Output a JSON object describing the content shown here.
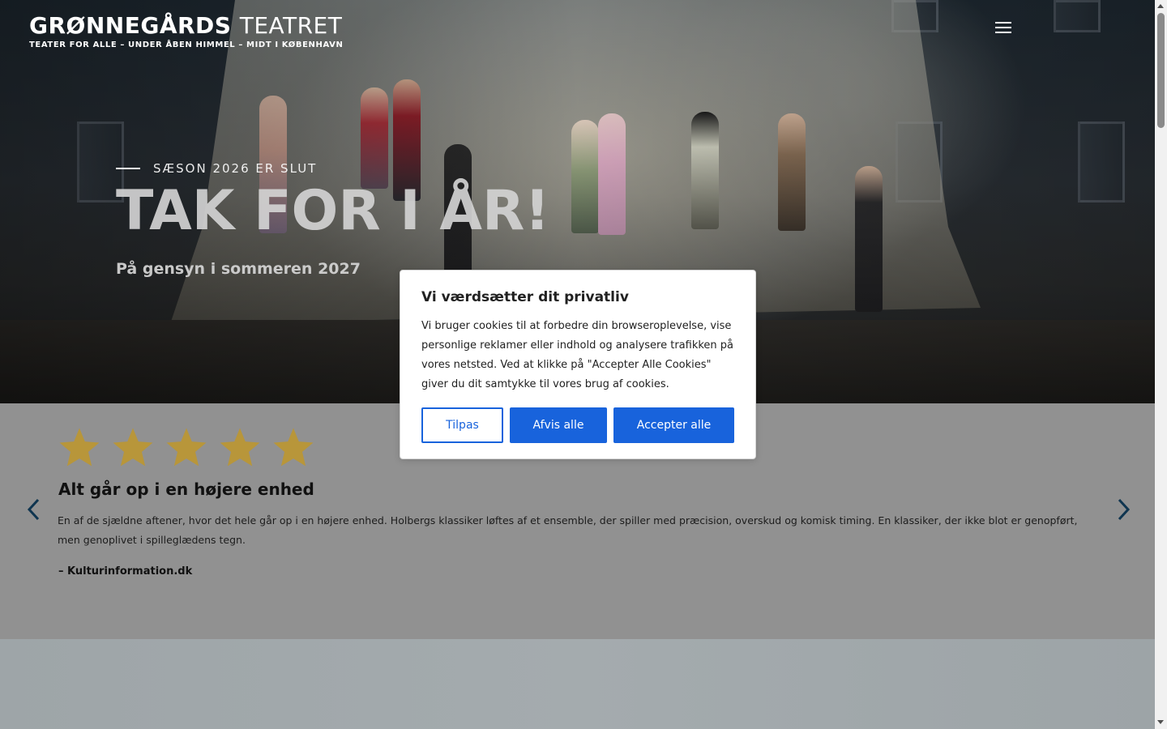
{
  "header": {
    "logo_bold": "GRØNNEGÅRDS",
    "logo_light": "TEATRET",
    "logo_tagline": "TEATER FOR ALLE – UNDER ÅBEN HIMMEL – MIDT I KØBENHAVN",
    "menu_icon": "hamburger-menu-icon"
  },
  "hero": {
    "eyebrow": "SÆSON 2026 ER SLUT",
    "title": "TAK FOR I ÅR!",
    "subtitle": "På gensyn i sommeren 2027"
  },
  "review": {
    "rating": 5,
    "rating_max": 5,
    "star_color": "#b8963a",
    "title": "Alt går op i en højere enhed",
    "body": "En af de sjældne aftener, hvor det hele går op i en højere enhed. Holbergs klassiker løftes af et ensemble, der spiller med præcision, overskud og komisk timing. En klassiker, der ikke blot er genopført, men genoplivet i spilleglædens tegn.",
    "source": "– Kulturinformation.dk",
    "prev_icon": "chevron-left-icon",
    "next_icon": "chevron-right-icon",
    "arrow_color": "#0f3550"
  },
  "cookie": {
    "title": "Vi værdsætter dit privatliv",
    "text": "Vi bruger cookies til at forbedre din browseroplevelse, vise personlige reklamer eller indhold og analysere trafikken på vores netsted. Ved at klikke på \"Accepter Alle Cookies\" giver du dit samtykke til vores brug af cookies.",
    "customize_label": "Tilpas",
    "reject_label": "Afvis alle",
    "accept_label": "Accepter alle",
    "accent_color": "#1863dc"
  }
}
